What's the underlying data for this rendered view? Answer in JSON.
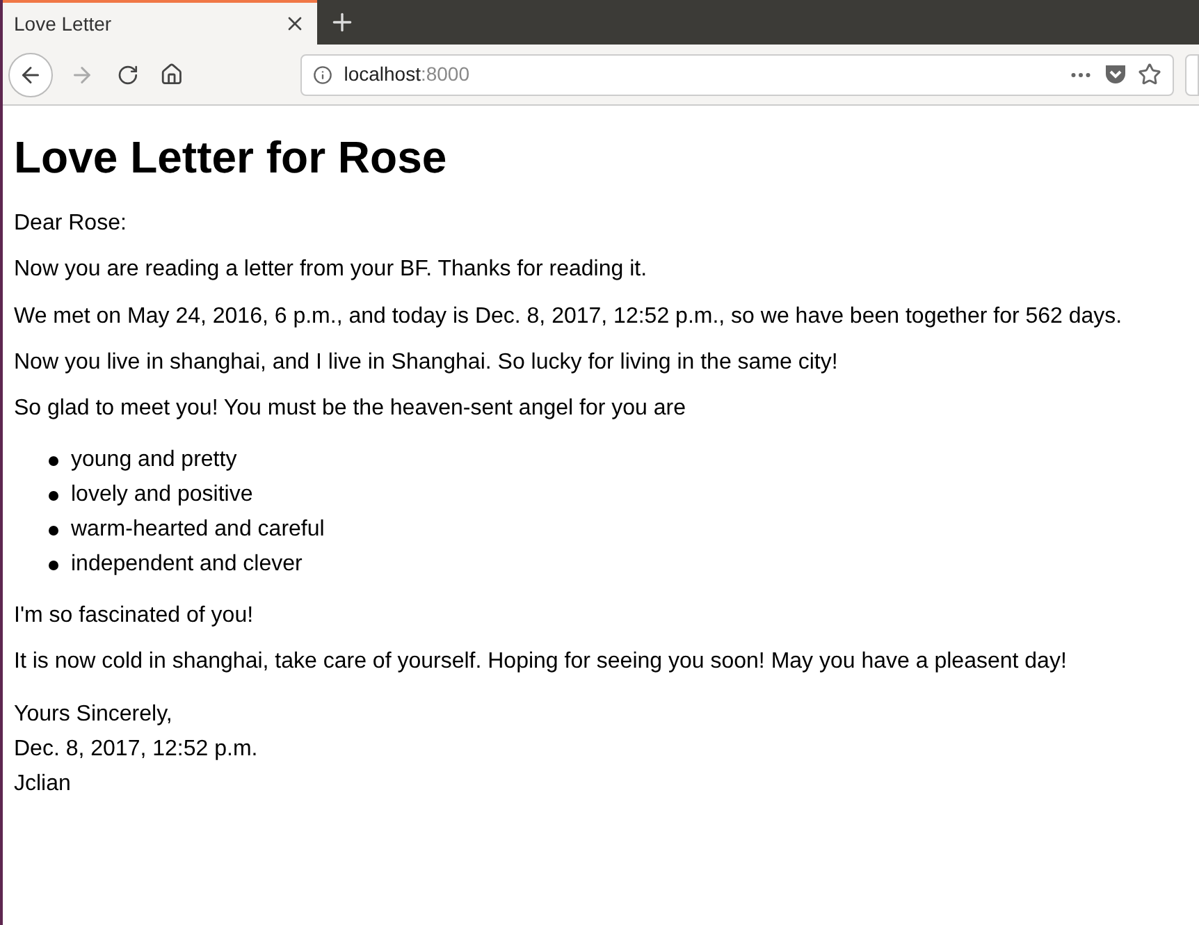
{
  "tabs": [
    {
      "title": "Love Letter",
      "selected": true
    }
  ],
  "address_bar": {
    "host": "localhost",
    "port": ":8000"
  },
  "page": {
    "heading": "Love Letter for Rose",
    "paragraphs_before": [
      "Dear Rose:",
      "Now you are reading a letter from your BF. Thanks for reading it.",
      "We met on May 24, 2016, 6 p.m., and today is Dec. 8, 2017, 12:52 p.m., so we have been together for 562 days.",
      "Now you live in shanghai, and I live in Shanghai. So lucky for living in the same city!",
      "So glad to meet you! You must be the heaven-sent angel for you are"
    ],
    "list": [
      "young and pretty",
      "lovely and positive",
      "warm-hearted and careful",
      "independent and clever"
    ],
    "paragraphs_after": [
      "I'm so fascinated of you!",
      "It is now cold in shanghai, take care of yourself. Hoping for seeing you soon! May you have a pleasent day!"
    ],
    "signature": [
      "Yours Sincerely,",
      "Dec. 8, 2017, 12:52 p.m.",
      "Jclian"
    ]
  }
}
